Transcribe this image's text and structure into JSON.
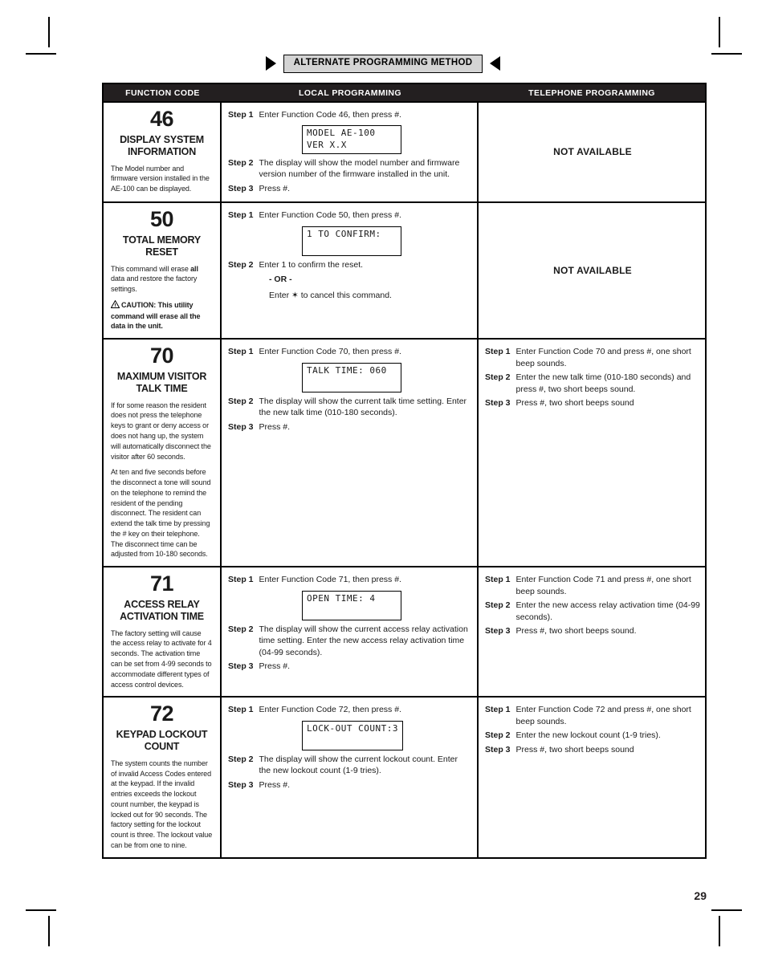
{
  "banner": {
    "label": "ALTERNATE PROGRAMMING METHOD",
    "left_arrow_icon": "triangle-right-icon",
    "right_arrow_icon": "triangle-left-icon"
  },
  "table": {
    "headers": {
      "function_code": "FUNCTION CODE",
      "local_programming": "LOCAL PROGRAMMING",
      "telephone_programming": "TELEPHONE PROGRAMMING"
    },
    "not_available_label": "NOT AVAILABLE",
    "rows": [
      {
        "code": "46",
        "title": "DISPLAY SYSTEM INFORMATION",
        "desc1": "The Model number and firmware version installed in the AE-100 can be displayed.",
        "local": {
          "step1_label": "Step 1",
          "step1_text": "Enter Function Code 46, then press #.",
          "lcd": "MODEL AE-100\nVER X.X",
          "step2_label": "Step 2",
          "step2_text": "The display will show the model number and firmware version number of the firmware installed in the unit.",
          "step3_label": "Step 3",
          "step3_text": "Press #."
        },
        "telephone": {
          "available": false
        }
      },
      {
        "code": "50",
        "title": "TOTAL MEMORY RESET",
        "desc1_a": "This command will erase ",
        "desc1_b": "all",
        "desc1_c": " data and restore the factory settings.",
        "caution_icon": "warning-triangle-icon",
        "caution": "CAUTION: This utility command will erase all the data in the unit.",
        "local": {
          "step1_label": "Step 1",
          "step1_text": "Enter Function Code 50, then press #.",
          "lcd": "1 TO CONFIRM:",
          "step2_label": "Step 2",
          "step2_text": "Enter 1 to confirm the reset.",
          "or_text": "- OR -",
          "cancel_text": "Enter ✶ to cancel this command."
        },
        "telephone": {
          "available": false
        }
      },
      {
        "code": "70",
        "title": "MAXIMUM VISITOR TALK TIME",
        "desc1": "If for some reason the resident does not press the telephone keys to grant or deny access or does not hang up, the system will automatically disconnect the visitor after 60 seconds.",
        "desc2": "At ten and five seconds before the disconnect a tone will sound on the telephone to remind the resident of the pending disconnect. The resident can extend the talk time by pressing the # key on their telephone. The disconnect time can be adjusted from 10-180 seconds.",
        "local": {
          "step1_label": "Step 1",
          "step1_text": "Enter Function Code 70, then press #.",
          "lcd": "TALK TIME: 060",
          "step2_label": "Step 2",
          "step2_text": "The display will show the current talk time setting. Enter the new talk time (010-180 seconds).",
          "step3_label": "Step 3",
          "step3_text": "Press #."
        },
        "telephone": {
          "available": true,
          "step1_label": "Step 1",
          "step1_text": "Enter Function Code 70 and press #, one short beep sounds.",
          "step2_label": "Step 2",
          "step2_text": "Enter the new talk time (010-180 seconds) and press #, two short beeps sound.",
          "step3_label": "Step 3",
          "step3_text": "Press #, two short beeps sound"
        }
      },
      {
        "code": "71",
        "title": "ACCESS RELAY ACTIVATION TIME",
        "desc1": "The factory setting will cause the access relay to activate for 4 seconds. The activation time can be set from 4-99 seconds to accommodate different types of access control devices.",
        "local": {
          "step1_label": "Step 1",
          "step1_text": "Enter Function Code 71, then press #.",
          "lcd": "OPEN TIME: 4",
          "step2_label": "Step 2",
          "step2_text": "The display will show the current access relay activation time setting. Enter the new access relay activation time (04-99 seconds).",
          "step3_label": "Step 3",
          "step3_text": "Press #."
        },
        "telephone": {
          "available": true,
          "step1_label": "Step 1",
          "step1_text": "Enter Function Code 71 and press #, one short beep sounds.",
          "step2_label": "Step 2",
          "step2_text": "Enter the new access relay activation time (04-99 seconds).",
          "step3_label": "Step 3",
          "step3_text": "Press #, two short beeps sound."
        }
      },
      {
        "code": "72",
        "title": "KEYPAD LOCKOUT COUNT",
        "desc1": "The system counts the number of invalid Access Codes entered at the keypad. If the invalid entries exceeds the lockout count number, the keypad is locked out for 90 seconds. The factory setting for the lockout count is three. The lockout value can be from one to nine.",
        "local": {
          "step1_label": "Step 1",
          "step1_text": "Enter Function Code 72, then press #.",
          "lcd": "LOCK-OUT COUNT:3",
          "step2_label": "Step 2",
          "step2_text": "The display will show the current lockout count. Enter the new lockout count (1-9 tries).",
          "step3_label": "Step 3",
          "step3_text": "Press #."
        },
        "telephone": {
          "available": true,
          "step1_label": "Step 1",
          "step1_text": "Enter Function Code 72 and press #, one short beep sounds.",
          "step2_label": "Step 2",
          "step2_text": "Enter the new lockout count (1-9 tries).",
          "step3_label": "Step 3",
          "step3_text": "Press #, two short beeps sound"
        }
      }
    ]
  },
  "page_number": "29"
}
